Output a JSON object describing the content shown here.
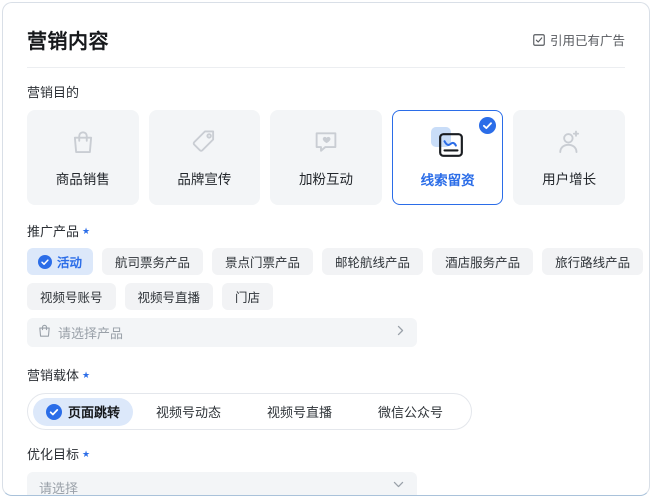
{
  "colors": {
    "accent": "#2b6de8",
    "accent_light_bg": "#dce8fa",
    "card_bg": "#f3f5f7",
    "selected_card_border": "#2b6de8",
    "panel_border": "#d9dfe7",
    "panel_border_bottom": "#a9c2da",
    "placeholder_text": "#9aa1a9",
    "icon_gray": "#c9cdd3"
  },
  "icons": {
    "quote": "quote-checkbox-icon",
    "check": "check-circle-icon",
    "bag": "shopping-bag-icon",
    "tag": "price-tag-icon",
    "chat_heart": "chat-heart-icon",
    "lead_chart": "chart-board-icon",
    "user_plus": "user-plus-icon",
    "chevron_right": "chevron-right-icon",
    "chevron_down": "chevron-down-icon"
  },
  "header": {
    "title": "营销内容",
    "quote_link": "引用已有广告"
  },
  "required_mark": "★",
  "purpose": {
    "label": "营销目的",
    "cards": [
      {
        "label": "商品销售",
        "selected": false
      },
      {
        "label": "品牌宣传",
        "selected": false
      },
      {
        "label": "加粉互动",
        "selected": false
      },
      {
        "label": "线索留资",
        "selected": true
      },
      {
        "label": "用户增长",
        "selected": false
      }
    ]
  },
  "product": {
    "label": "推广产品",
    "tags_row1": [
      {
        "label": "活动",
        "selected": true
      },
      {
        "label": "航司票务产品",
        "selected": false
      },
      {
        "label": "景点门票产品",
        "selected": false
      },
      {
        "label": "邮轮航线产品",
        "selected": false
      },
      {
        "label": "酒店服务产品",
        "selected": false
      },
      {
        "label": "旅行路线产品",
        "selected": false
      }
    ],
    "tags_row2": [
      {
        "label": "视频号账号",
        "selected": false
      },
      {
        "label": "视频号直播",
        "selected": false
      },
      {
        "label": "门店",
        "selected": false
      }
    ],
    "picker_placeholder": "请选择产品"
  },
  "carrier": {
    "label": "营销载体",
    "options": [
      {
        "label": "页面跳转",
        "selected": true
      },
      {
        "label": "视频号动态",
        "selected": false
      },
      {
        "label": "视频号直播",
        "selected": false
      },
      {
        "label": "微信公众号",
        "selected": false
      }
    ]
  },
  "goal": {
    "label": "优化目标",
    "select_placeholder": "请选择"
  }
}
